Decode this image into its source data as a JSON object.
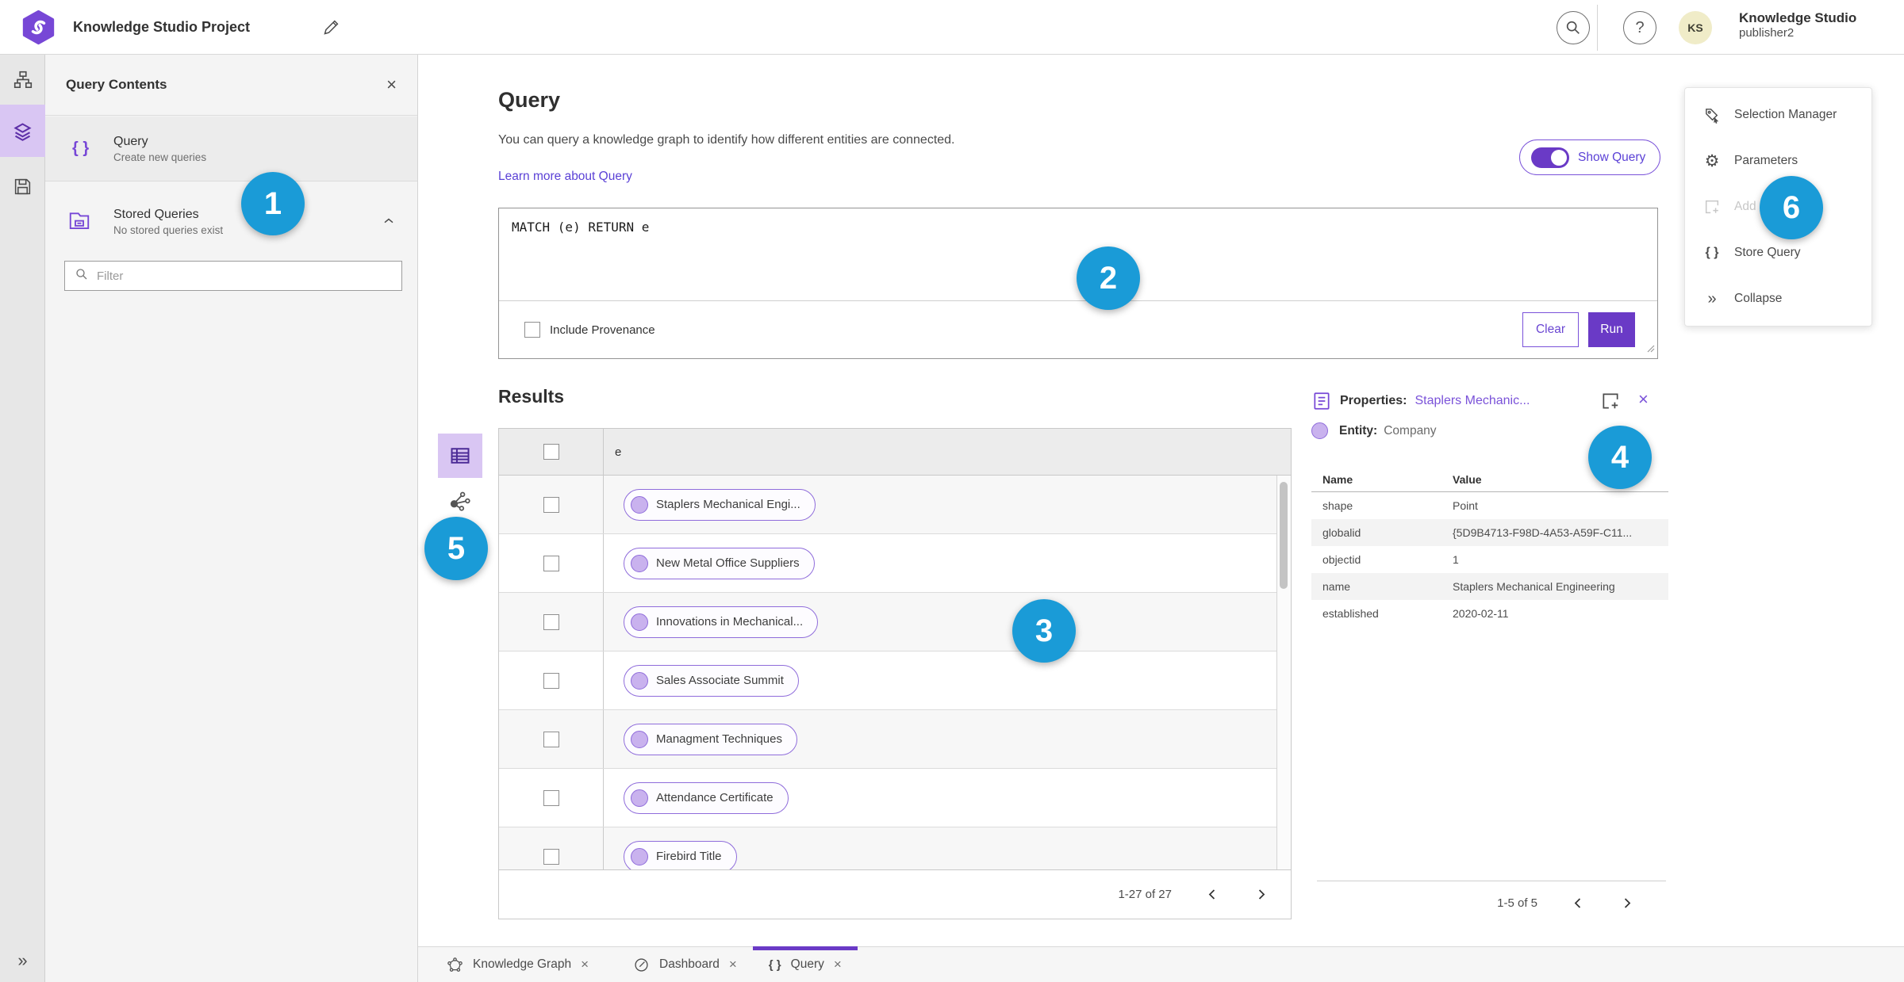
{
  "colors": {
    "accent_purple": "#6a3ac6",
    "link_purple": "#5b41d6",
    "badge_blue": "#1a9bd7",
    "pill_border": "#8f6cdb",
    "rail_selected_bg": "#d9c6f3"
  },
  "icons": {
    "close": "×",
    "collapse": "»",
    "expand": "»",
    "braces": "{ }",
    "gear": "⚙"
  },
  "topbar": {
    "title": "Knowledge Studio Project",
    "user_initials": "KS",
    "user_name": "Knowledge Studio",
    "user_role": "publisher2"
  },
  "contents_panel": {
    "title": "Query Contents",
    "query_item": {
      "title": "Query",
      "subtitle": "Create new queries"
    },
    "stored_item": {
      "title": "Stored Queries",
      "subtitle": "No stored queries exist"
    },
    "filter_placeholder": "Filter"
  },
  "query": {
    "heading": "Query",
    "description": "You can query a knowledge graph to identify how different entities are connected.",
    "learn_more": "Learn more about Query",
    "show_query": "Show Query",
    "code": "MATCH (e) RETURN e",
    "include_provenance": "Include Provenance",
    "clear": "Clear",
    "run": "Run"
  },
  "results": {
    "heading": "Results",
    "column_header": "e",
    "rows": [
      "Staplers Mechanical Engi...",
      "New Metal Office Suppliers",
      "Innovations in Mechanical...",
      "Sales Associate Summit",
      "Managment Techniques",
      "Attendance Certificate",
      "Firebird Title"
    ],
    "pagination": "1-27 of 27"
  },
  "properties": {
    "label": "Properties:",
    "entity_link": "Staplers Mechanic...",
    "entity_label": "Entity:",
    "entity_value": "Company",
    "col_name": "Name",
    "col_value": "Value",
    "rows": [
      {
        "name": "shape",
        "value": "Point"
      },
      {
        "name": "globalid",
        "value": "{5D9B4713-F98D-4A53-A59F-C11..."
      },
      {
        "name": "objectid",
        "value": "1"
      },
      {
        "name": "name",
        "value": "Staplers Mechanical Engineering"
      },
      {
        "name": "established",
        "value": "2020-02-11"
      }
    ],
    "pagination": "1-5 of 5"
  },
  "side_menu": {
    "items": [
      "Selection Manager",
      "Parameters",
      "Add",
      "Store Query",
      "Collapse"
    ]
  },
  "tabs": [
    {
      "label": "Knowledge Graph"
    },
    {
      "label": "Dashboard"
    },
    {
      "label": "Query"
    }
  ],
  "badges": [
    "1",
    "2",
    "3",
    "4",
    "5",
    "6"
  ]
}
